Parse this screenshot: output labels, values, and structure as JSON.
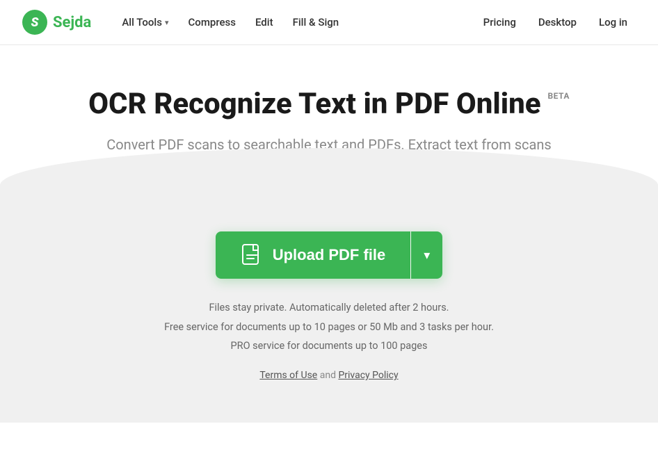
{
  "nav": {
    "logo_letter": "S",
    "logo_text": "Sejda",
    "links": [
      {
        "label": "All Tools",
        "has_dropdown": true
      },
      {
        "label": "Compress",
        "has_dropdown": false
      },
      {
        "label": "Edit",
        "has_dropdown": false
      },
      {
        "label": "Fill & Sign",
        "has_dropdown": false
      }
    ],
    "right_links": [
      {
        "label": "Pricing"
      },
      {
        "label": "Desktop"
      },
      {
        "label": "Log in"
      }
    ]
  },
  "hero": {
    "title": "OCR Recognize Text in PDF Online",
    "beta": "BETA",
    "subtitle": "Convert PDF scans to searchable text and PDFs. Extract text from scans"
  },
  "upload": {
    "button_label": "Upload PDF file",
    "button_icon_aria": "pdf-file-icon"
  },
  "info": {
    "line1": "Files stay private. Automatically deleted after 2 hours.",
    "line2": "Free service for documents up to 10 pages or 50 Mb and 3 tasks per hour.",
    "line3": "PRO service for documents up to 100 pages"
  },
  "terms": {
    "prefix": "",
    "terms_label": "Terms of Use",
    "conjunction": "and",
    "privacy_label": "Privacy Policy"
  }
}
